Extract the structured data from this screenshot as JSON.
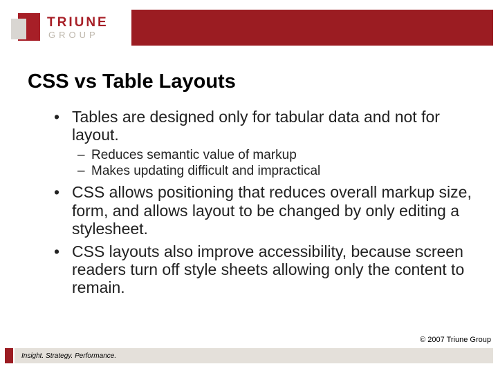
{
  "logo": {
    "name": "TRIUNE",
    "sub": "GROUP"
  },
  "title": "CSS vs Table Layouts",
  "bullets": {
    "b1": "Tables are designed only for tabular data and not for layout.",
    "b1s1": "Reduces semantic value of markup",
    "b1s2": "Makes updating difficult and impractical",
    "b2": "CSS allows positioning that reduces overall markup size, form, and allows layout to be changed by only editing a stylesheet.",
    "b3": "CSS layouts also improve accessibility, because screen readers turn off style sheets allowing only the content to remain."
  },
  "copyright": "© 2007 Triune Group",
  "tagline": "Insight. Strategy. Performance."
}
